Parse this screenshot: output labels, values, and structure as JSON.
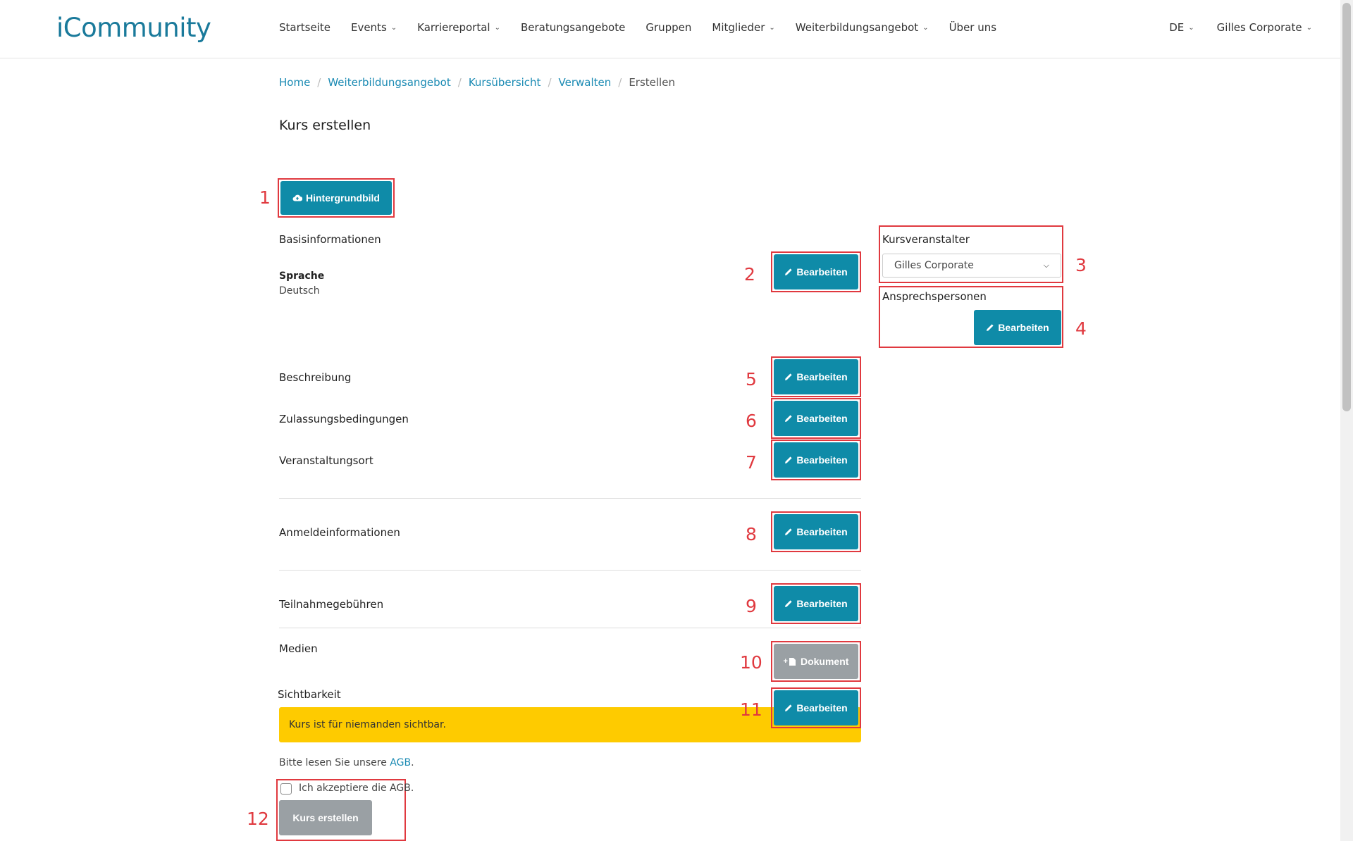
{
  "header": {
    "logo": "iCommunity",
    "nav": [
      {
        "label": "Startseite",
        "dropdown": false
      },
      {
        "label": "Events",
        "dropdown": true
      },
      {
        "label": "Karriereportal",
        "dropdown": true
      },
      {
        "label": "Beratungsangebote",
        "dropdown": false
      },
      {
        "label": "Gruppen",
        "dropdown": false
      },
      {
        "label": "Mitglieder",
        "dropdown": true
      },
      {
        "label": "Weiterbildungsangebot",
        "dropdown": true
      },
      {
        "label": "Über uns",
        "dropdown": false
      }
    ],
    "language": "DE",
    "user": "Gilles Corporate"
  },
  "breadcrumb": [
    "Home",
    "Weiterbildungsangebot",
    "Kursübersicht",
    "Verwalten",
    "Erstellen"
  ],
  "page_title": "Kurs erstellen",
  "background_button": "Hintergrundbild",
  "edit_label": "Bearbeiten",
  "sections": {
    "basis": "Basisinformationen",
    "sprache_label": "Sprache",
    "sprache_value": "Deutsch",
    "beschreibung": "Beschreibung",
    "zulassung": "Zulassungsbedingungen",
    "veranstaltungsort": "Veranstaltungsort",
    "anmeldeinfo": "Anmeldeinformationen",
    "gebuehren": "Teilnahmegebühren",
    "medien": "Medien",
    "sichtbarkeit": "Sichtbarkeit"
  },
  "sidebar": {
    "kursveranstalter_label": "Kursveranstalter",
    "kursveranstalter_value": "Gilles Corporate",
    "ansprechpersonen_label": "Ansprechspersonen"
  },
  "dokument_button": "Dokument",
  "visibility_alert": "Kurs ist für niemanden sichtbar.",
  "agb": {
    "prefix": "Bitte lesen Sie unsere ",
    "link": "AGB",
    "suffix": ".",
    "checkbox_label": "Ich akzeptiere die AGB.",
    "checked": false
  },
  "submit_button": "Kurs erstellen",
  "annotations": [
    "1",
    "2",
    "3",
    "4",
    "5",
    "6",
    "7",
    "8",
    "9",
    "10",
    "11",
    "12"
  ],
  "colors": {
    "primary": "#0f8ba8",
    "annotation": "#e0393f",
    "alert": "#fecb00",
    "disabled": "#9aa0a4"
  }
}
